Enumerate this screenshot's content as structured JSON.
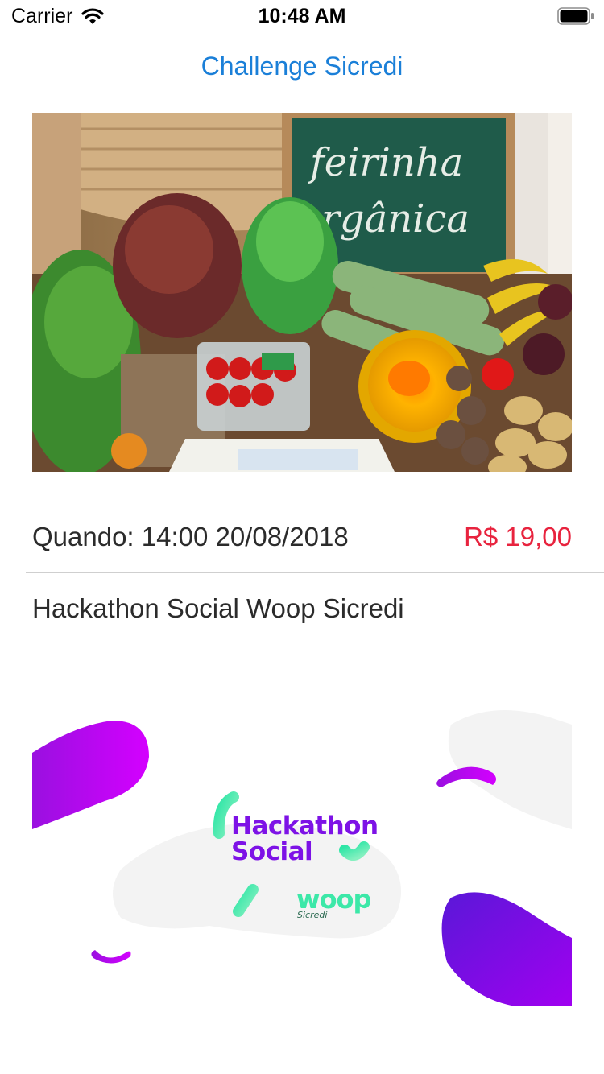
{
  "status_bar": {
    "carrier": "Carrier",
    "time": "10:48 AM",
    "wifi_icon": "wifi-icon",
    "battery_icon": "battery-icon"
  },
  "nav": {
    "title": "Challenge Sicredi",
    "title_color": "#1a7fd8"
  },
  "product": {
    "image_icon": "organic-produce-photo",
    "chalkboard_line1": "feirinha",
    "chalkboard_line2": "orgânica",
    "when": "Quando: 14:00 20/08/2018",
    "price": "R$ 19,00",
    "price_color": "#e8233e"
  },
  "event": {
    "description": "Hackathon Social Woop Sicredi"
  },
  "banner": {
    "title_line1": "Hackathon",
    "title_line2": "Social",
    "brand": "woop",
    "brand_sub": "Sicredi",
    "accent_purple": "#7d12e6",
    "accent_green": "#3ce8a8"
  }
}
